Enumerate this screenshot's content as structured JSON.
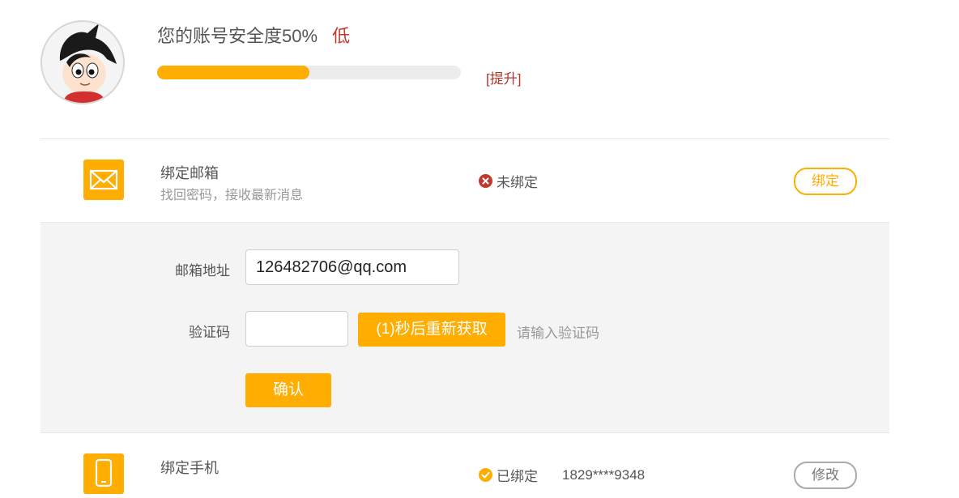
{
  "security": {
    "title": "您的账号安全度50%",
    "level": "低",
    "progress_percent": 50,
    "upgrade_link": "[提升]",
    "accent_color": "#ffad00",
    "danger_color": "#c0392b"
  },
  "email_row": {
    "title": "绑定邮箱",
    "description": "找回密码，接收最新消息",
    "status": "未绑定",
    "status_icon": "x-circle-icon",
    "action_label": "绑定",
    "icon": "envelope-icon"
  },
  "email_form": {
    "email_label": "邮箱地址",
    "email_value": "126482706@qq.com",
    "code_label": "验证码",
    "code_value": "",
    "resend_label": "(1)秒后重新获取",
    "hint": "请输入验证码",
    "confirm_label": "确认"
  },
  "phone_row": {
    "title": "绑定手机",
    "status": "已绑定",
    "status_icon": "check-circle-icon",
    "phone": "1829****9348",
    "action_label": "修改",
    "icon": "phone-icon"
  }
}
